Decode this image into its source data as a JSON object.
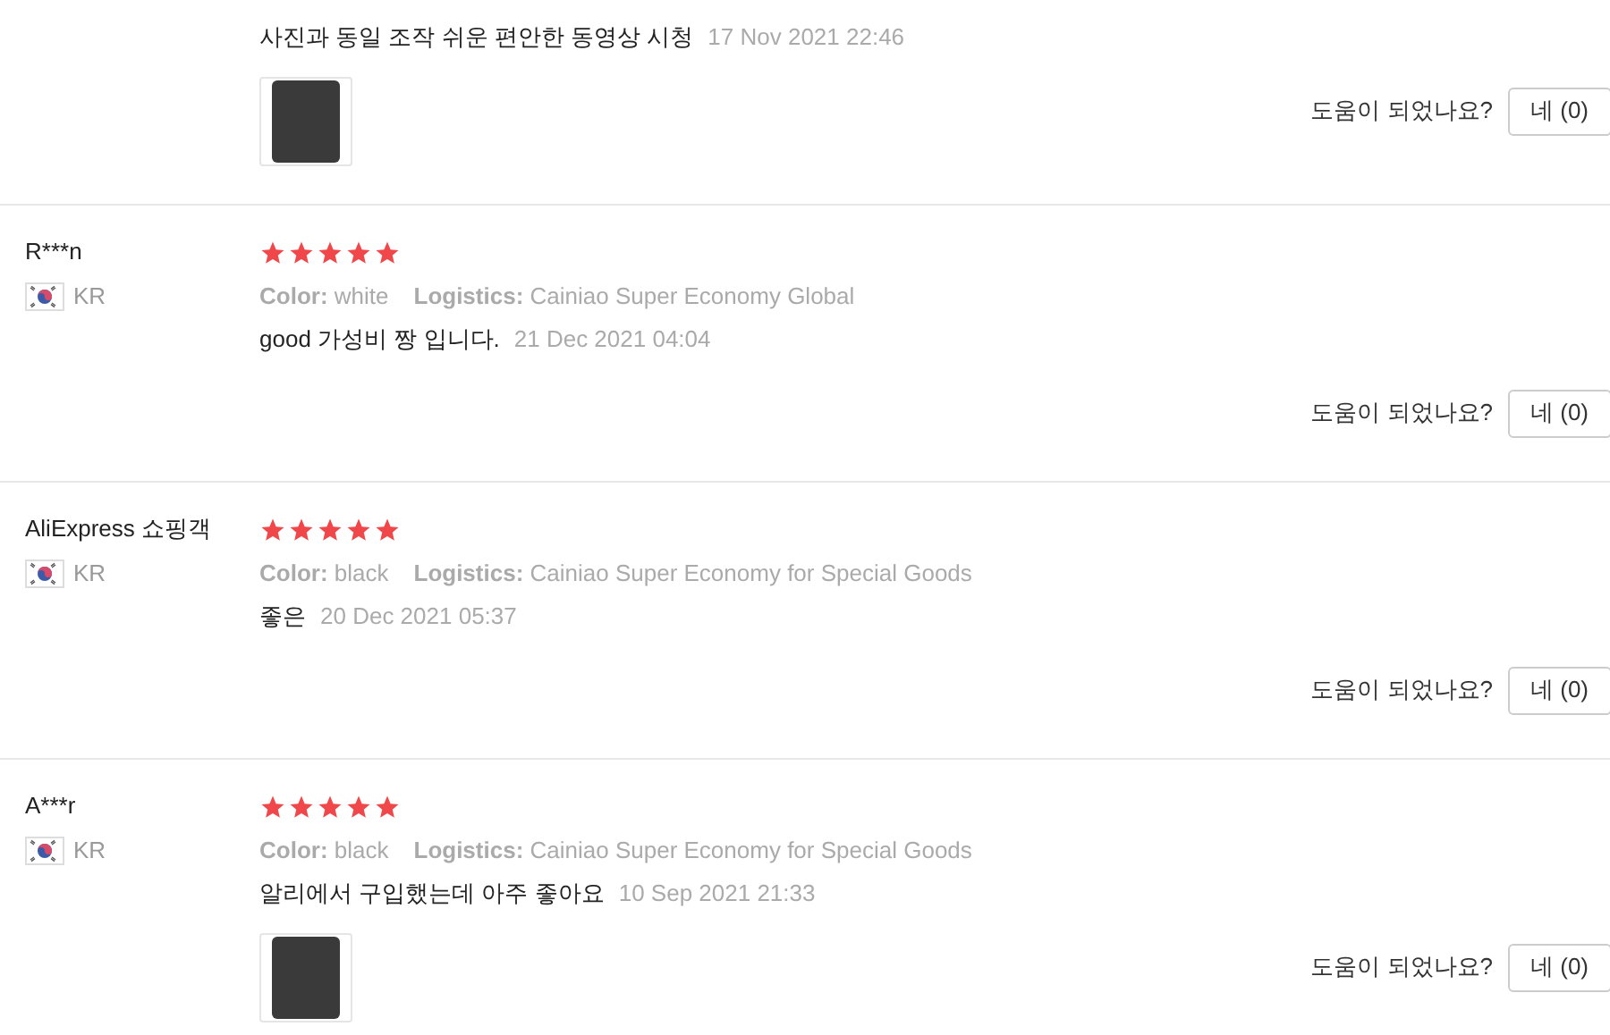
{
  "reviews": [
    {
      "comment": "사진과 동일 조작 쉬운 편안한 동영상 시청",
      "date": "17 Nov 2021 22:46",
      "photo": true,
      "helpful": {
        "question": "도움이 되었나요?",
        "button": "네 (0)"
      }
    },
    {
      "name": "R***n",
      "country": "KR",
      "stars": 5,
      "attributes": [
        "**Color:** white",
        "**Logistics:** Cainiao Super Economy Global"
      ],
      "comment": "good 가성비 짱 입니다.",
      "date": "21 Dec 2021 04:04",
      "photo": false,
      "helpful": {
        "question": "도움이 되었나요?",
        "button": "네 (0)"
      }
    },
    {
      "name": "AliExpress 쇼핑객",
      "country": "KR",
      "stars": 5,
      "attributes": [
        "**Color:** black",
        "**Logistics:** Cainiao Super Economy for Special Goods"
      ],
      "comment": "좋은",
      "date": "20 Dec 2021 05:37",
      "photo": false,
      "helpful": {
        "question": "도움이 되었나요?",
        "button": "네 (0)"
      }
    },
    {
      "name": "A***r",
      "country": "KR",
      "stars": 5,
      "attributes": [
        "**Color:** black",
        "**Logistics:** Cainiao Super Economy for Special Goods"
      ],
      "comment": "알리에서 구입했는데 아주 좋아요",
      "date": "10 Sep 2021 21:33",
      "photo": true,
      "helpful": {
        "question": "도움이 되었나요?",
        "button": "네 (0)"
      }
    }
  ]
}
